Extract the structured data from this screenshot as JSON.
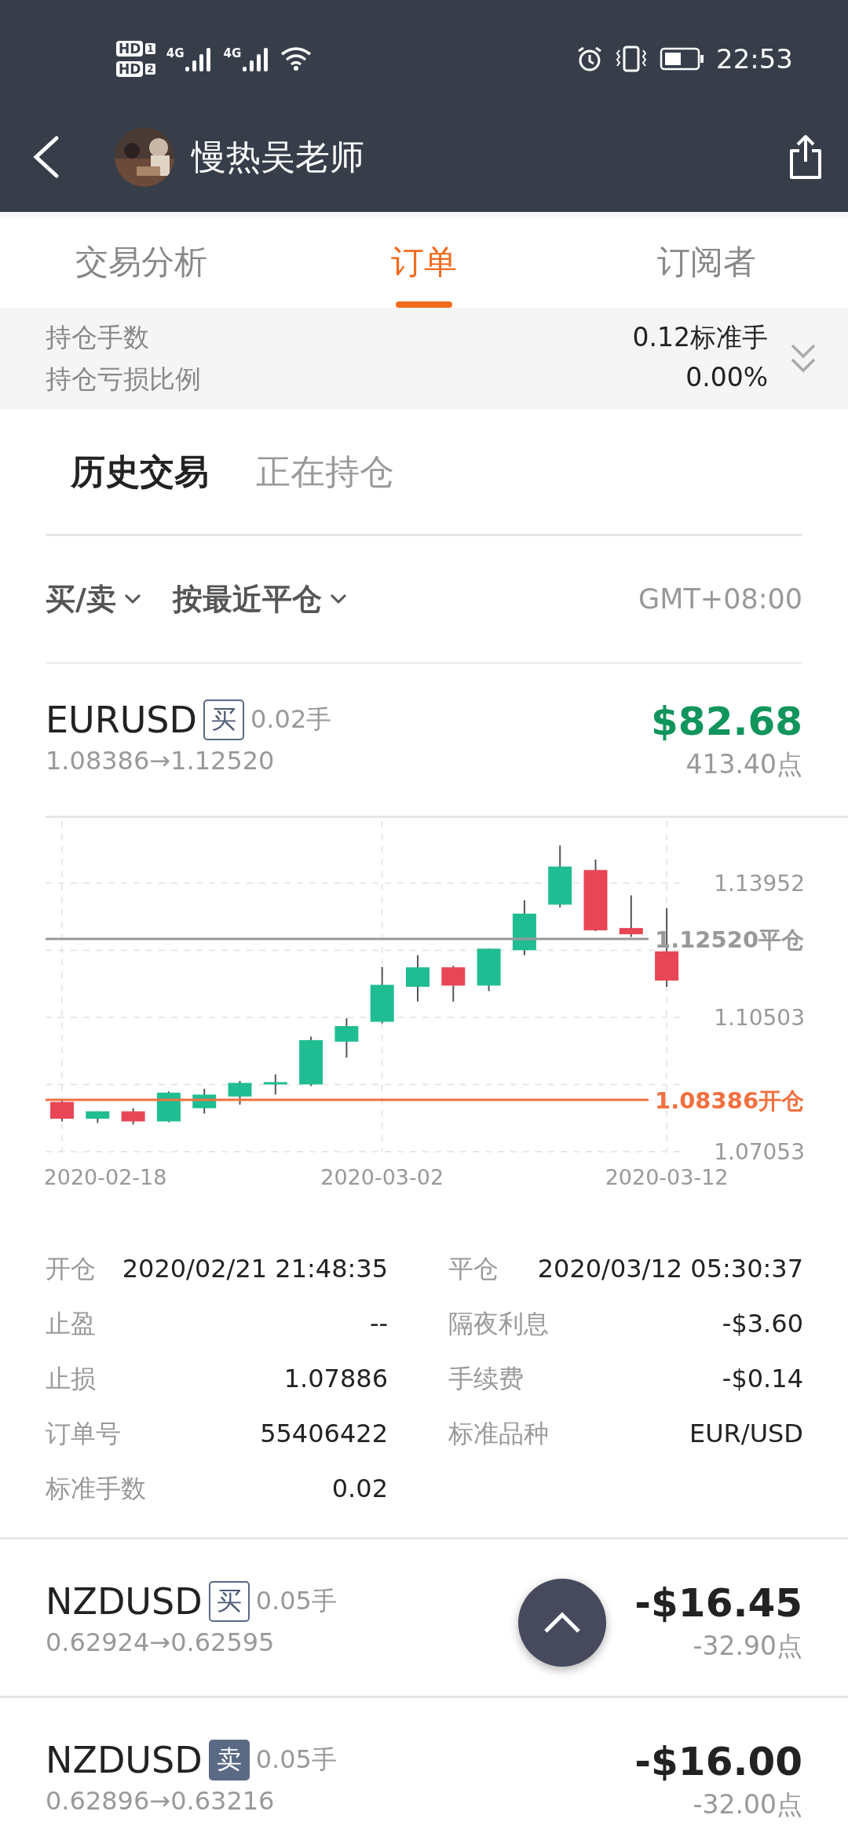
{
  "status_bar": {
    "sims": [
      {
        "hd": "HD",
        "slot": "1"
      },
      {
        "hd": "HD",
        "slot": "2"
      }
    ],
    "networks": [
      "4G",
      "4G"
    ],
    "time": "22:53"
  },
  "header": {
    "title": "慢热吴老师"
  },
  "tabs": [
    {
      "label": "交易分析",
      "selected": false
    },
    {
      "label": "订单",
      "selected": true
    },
    {
      "label": "订阅者",
      "selected": false
    }
  ],
  "summary": [
    {
      "label": "持仓手数",
      "value": "0.12标准手"
    },
    {
      "label": "持仓亏损比例",
      "value": "0.00%"
    }
  ],
  "sub_tabs": [
    {
      "label": "历史交易",
      "selected": true
    },
    {
      "label": "正在持仓",
      "selected": false
    }
  ],
  "filters": [
    {
      "label": "买/卖"
    },
    {
      "label": "按最近平仓"
    }
  ],
  "timezone": "GMT+08:00",
  "orders": [
    {
      "symbol": "EURUSD",
      "kind": "buy",
      "side_label": "买",
      "lots": "0.02手",
      "prices": "1.08386→1.12520",
      "profit": "$82.68",
      "color": "#11955c",
      "points": "413.40点",
      "chart": {
        "y_labels": [
          "1.13952",
          "1.10503",
          "1.07053"
        ],
        "x_labels": [
          "2020-02-18",
          "2020-03-02",
          "2020-03-12"
        ],
        "price_lines": [
          {
            "kind": "close",
            "label": "1.12520平仓"
          },
          {
            "kind": "open",
            "label": "1.08386开仓"
          }
        ]
      },
      "details": [
        {
          "label": "开仓",
          "value": "2020/02/21 21:48:35"
        },
        {
          "label": "平仓",
          "value": "2020/03/12 05:30:37"
        },
        {
          "label": "止盈",
          "value": "--"
        },
        {
          "label": "隔夜利息",
          "value": "-$3.60"
        },
        {
          "label": "止损",
          "value": "1.07886"
        },
        {
          "label": "手续费",
          "value": "-$0.14"
        },
        {
          "label": "订单号",
          "value": "55406422"
        },
        {
          "label": "标准品种",
          "value": "EUR/USD"
        },
        {
          "label": "标准手数",
          "value": "0.02"
        }
      ]
    },
    {
      "symbol": "NZDUSD",
      "kind": "buy",
      "side_label": "买",
      "lots": "0.05手",
      "prices": "0.62924→0.62595",
      "profit": "-$16.45",
      "color": "#222222",
      "points": "-32.90点"
    },
    {
      "symbol": "NZDUSD",
      "kind": "sell",
      "side_label": "卖",
      "lots": "0.05手",
      "prices": "0.62896→0.63216",
      "profit": "-$16.00",
      "color": "#222222",
      "points": "-32.00点"
    }
  ]
}
